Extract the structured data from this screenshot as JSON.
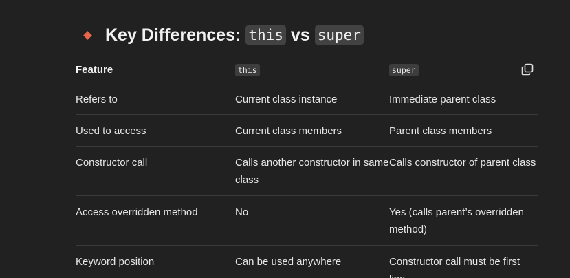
{
  "heading": {
    "prefix": "Key Differences:",
    "code1": "this",
    "vs": "vs",
    "code2": "super"
  },
  "table": {
    "headers": {
      "feature": "Feature",
      "col2": "this",
      "col3": "super"
    },
    "rows": [
      {
        "feature": "Refers to",
        "this": "Current class instance",
        "super": "Immediate parent class"
      },
      {
        "feature": "Used to access",
        "this": "Current class members",
        "super": "Parent class members"
      },
      {
        "feature": "Constructor call",
        "this": "Calls another constructor in same class",
        "super": "Calls constructor of parent class"
      },
      {
        "feature": "Access overridden method",
        "this": "No",
        "super": "Yes (calls parent’s overridden method)"
      },
      {
        "feature": "Keyword position",
        "this": "Can be used anywhere",
        "super": "Constructor call must be first line"
      }
    ]
  },
  "icons": {
    "bullet": "orange-diamond-icon",
    "copy": "copy-icon"
  },
  "colors": {
    "background": "#212121",
    "accent": "#e8674a",
    "code_bg": "#424242"
  }
}
